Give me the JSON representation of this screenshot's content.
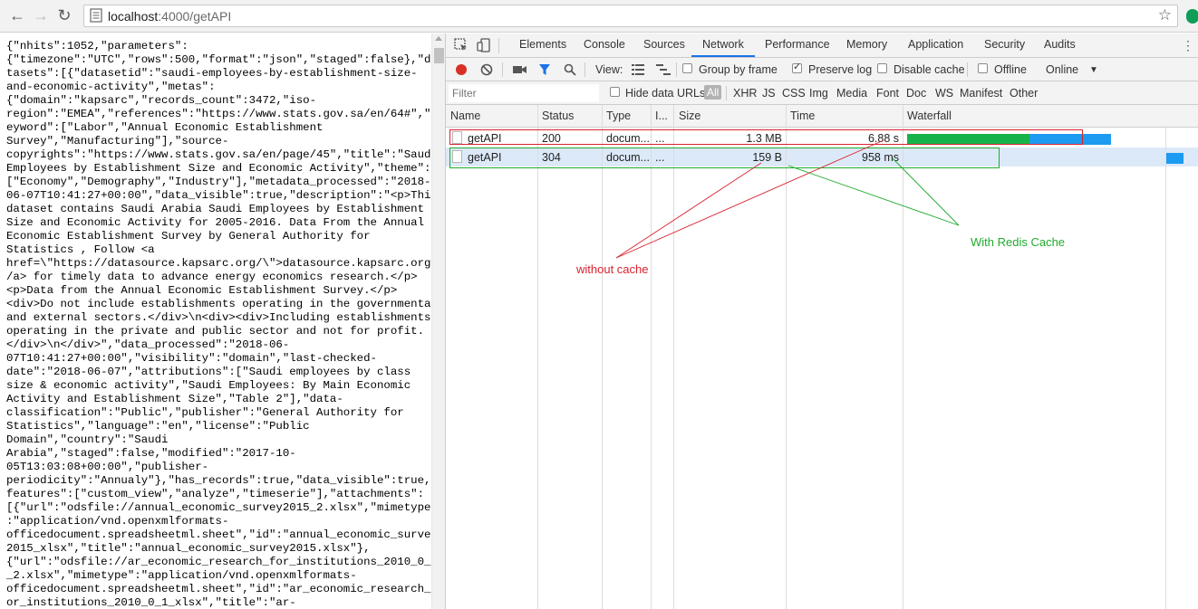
{
  "browser": {
    "url_host": "localhost",
    "url_path": ":4000/getAPI",
    "back_icon": "back-arrow-icon",
    "forward_icon": "forward-arrow-icon",
    "reload_icon": "reload-icon",
    "bookmark_icon": "star-icon"
  },
  "json_body": "{\"nhits\":1052,\"parameters\":\n{\"timezone\":\"UTC\",\"rows\":500,\"format\":\"json\",\"staged\":false},\"da\ntasets\":[{\"datasetid\":\"saudi-employees-by-establishment-size-\nand-economic-activity\",\"metas\":\n{\"domain\":\"kapsarc\",\"records_count\":3472,\"iso-\nregion\":\"EMEA\",\"references\":\"https://www.stats.gov.sa/en/64#\",\"k\neyword\":[\"Labor\",\"Annual Economic Establishment\nSurvey\",\"Manufacturing\"],\"source-\ncopyrights\":\"https://www.stats.gov.sa/en/page/45\",\"title\":\"Saudi\nEmployees by Establishment Size and Economic Activity\",\"theme\":\n[\"Economy\",\"Demography\",\"Industry\"],\"metadata_processed\":\"2018-\n06-07T10:41:27+00:00\",\"data_visible\":true,\"description\":\"<p>This\ndataset contains Saudi Arabia Saudi Employees by Establishment\nSize and Economic Activity for 2005-2016. Data From the Annual\nEconomic Establishment Survey by General Authority for\nStatistics , Follow <a\nhref=\\\"https://datasource.kapsarc.org/\\\">datasource.kapsarc.org<\n/a> for timely data to advance energy economics research.</p>\n<p>Data from the Annual Economic Establishment Survey.</p>\n<div>Do not include establishments operating in the governmental\nand external sectors.</div>\\n<div><div>Including establishments\noperating in the private and public sector and not for profit.\n</div>\\n</div>\",\"data_processed\":\"2018-06-\n07T10:41:27+00:00\",\"visibility\":\"domain\",\"last-checked-\ndate\":\"2018-06-07\",\"attributions\":[\"Saudi employees by class\nsize & economic activity\",\"Saudi Employees: By Main Economic\nActivity and Establishment Size\",\"Table 2\"],\"data-\nclassification\":\"Public\",\"publisher\":\"General Authority for\nStatistics\",\"language\":\"en\",\"license\":\"Public\nDomain\",\"country\":\"Saudi\nArabia\",\"staged\":false,\"modified\":\"2017-10-\n05T13:03:08+00:00\",\"publisher-\nperiodicity\":\"Annualy\"},\"has_records\":true,\"data_visible\":true,\"\nfeatures\":[\"custom_view\",\"analyze\",\"timeserie\"],\"attachments\":\n[{\"url\":\"odsfile://annual_economic_survey2015_2.xlsx\",\"mimetype\"\n:\"application/vnd.openxmlformats-\nofficedocument.spreadsheetml.sheet\",\"id\":\"annual_economic_survey\n2015_xlsx\",\"title\":\"annual_economic_survey2015.xlsx\"},\n{\"url\":\"odsfile://ar_economic_research_for_institutions_2010_0_1\n_2.xlsx\",\"mimetype\":\"application/vnd.openxmlformats-\nofficedocument.spreadsheetml.sheet\",\"id\":\"ar_economic_research_f\nor_institutions_2010_0_1_xlsx\",\"title\":\"ar-",
  "devtools": {
    "tabs": [
      "Elements",
      "Console",
      "Sources",
      "Network",
      "Performance",
      "Memory",
      "Application",
      "Security",
      "Audits"
    ],
    "active_tab": "Network",
    "toolbar": {
      "view_label": "View:",
      "group_by_frame": "Group by frame",
      "preserve_log": "Preserve log",
      "disable_cache": "Disable cache",
      "offline": "Offline",
      "online": "Online"
    },
    "filter": {
      "placeholder": "Filter",
      "hide_data_urls": "Hide data URLs",
      "all": "All",
      "types": [
        "XHR",
        "JS",
        "CSS",
        "Img",
        "Media",
        "Font",
        "Doc",
        "WS",
        "Manifest",
        "Other"
      ]
    },
    "columns": {
      "name": "Name",
      "status": "Status",
      "type": "Type",
      "initiator": "I...",
      "size": "Size",
      "time": "Time",
      "waterfall": "Waterfall"
    },
    "rows": [
      {
        "name": "getAPI",
        "status": "200",
        "type": "docum...",
        "initiator": "...",
        "size": "1.3 MB",
        "time": "6.88 s",
        "waterfall_wait_fraction": 0.58,
        "waterfall_download_fraction": 0.39
      },
      {
        "name": "getAPI",
        "status": "304",
        "type": "docum...",
        "initiator": "...",
        "size": "159 B",
        "time": "958 ms",
        "waterfall_wait_fraction": 0.0,
        "waterfall_download_fraction": 1.0
      }
    ]
  },
  "annotations": {
    "without_cache": "without cache",
    "with_cache": "With Redis Cache",
    "red_color": "#d9232e",
    "green_color": "#1faa2e"
  }
}
